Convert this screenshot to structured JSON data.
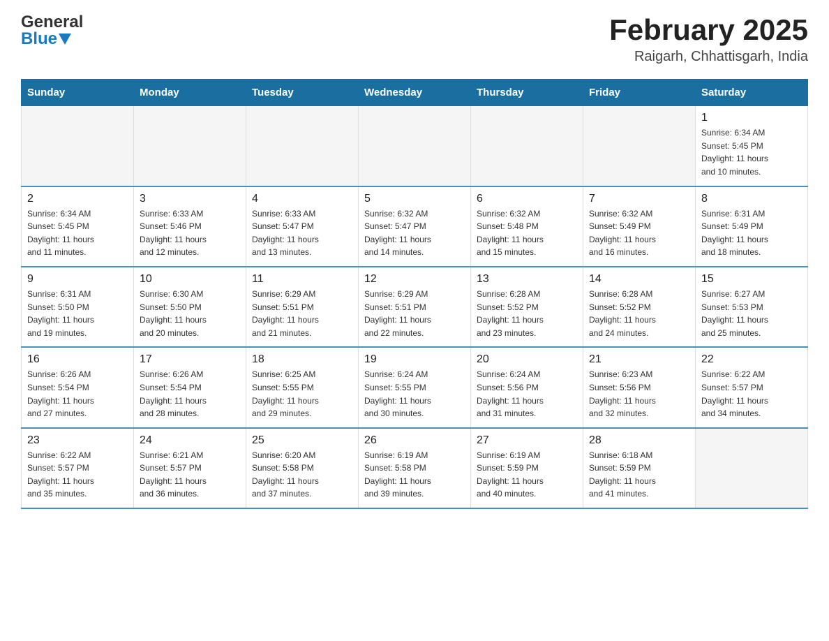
{
  "header": {
    "logo_general": "General",
    "logo_blue": "Blue",
    "month_title": "February 2025",
    "location": "Raigarh, Chhattisgarh, India"
  },
  "days_of_week": [
    "Sunday",
    "Monday",
    "Tuesday",
    "Wednesday",
    "Thursday",
    "Friday",
    "Saturday"
  ],
  "weeks": [
    {
      "days": [
        {
          "date": "",
          "info": ""
        },
        {
          "date": "",
          "info": ""
        },
        {
          "date": "",
          "info": ""
        },
        {
          "date": "",
          "info": ""
        },
        {
          "date": "",
          "info": ""
        },
        {
          "date": "",
          "info": ""
        },
        {
          "date": "1",
          "info": "Sunrise: 6:34 AM\nSunset: 5:45 PM\nDaylight: 11 hours\nand 10 minutes."
        }
      ]
    },
    {
      "days": [
        {
          "date": "2",
          "info": "Sunrise: 6:34 AM\nSunset: 5:45 PM\nDaylight: 11 hours\nand 11 minutes."
        },
        {
          "date": "3",
          "info": "Sunrise: 6:33 AM\nSunset: 5:46 PM\nDaylight: 11 hours\nand 12 minutes."
        },
        {
          "date": "4",
          "info": "Sunrise: 6:33 AM\nSunset: 5:47 PM\nDaylight: 11 hours\nand 13 minutes."
        },
        {
          "date": "5",
          "info": "Sunrise: 6:32 AM\nSunset: 5:47 PM\nDaylight: 11 hours\nand 14 minutes."
        },
        {
          "date": "6",
          "info": "Sunrise: 6:32 AM\nSunset: 5:48 PM\nDaylight: 11 hours\nand 15 minutes."
        },
        {
          "date": "7",
          "info": "Sunrise: 6:32 AM\nSunset: 5:49 PM\nDaylight: 11 hours\nand 16 minutes."
        },
        {
          "date": "8",
          "info": "Sunrise: 6:31 AM\nSunset: 5:49 PM\nDaylight: 11 hours\nand 18 minutes."
        }
      ]
    },
    {
      "days": [
        {
          "date": "9",
          "info": "Sunrise: 6:31 AM\nSunset: 5:50 PM\nDaylight: 11 hours\nand 19 minutes."
        },
        {
          "date": "10",
          "info": "Sunrise: 6:30 AM\nSunset: 5:50 PM\nDaylight: 11 hours\nand 20 minutes."
        },
        {
          "date": "11",
          "info": "Sunrise: 6:29 AM\nSunset: 5:51 PM\nDaylight: 11 hours\nand 21 minutes."
        },
        {
          "date": "12",
          "info": "Sunrise: 6:29 AM\nSunset: 5:51 PM\nDaylight: 11 hours\nand 22 minutes."
        },
        {
          "date": "13",
          "info": "Sunrise: 6:28 AM\nSunset: 5:52 PM\nDaylight: 11 hours\nand 23 minutes."
        },
        {
          "date": "14",
          "info": "Sunrise: 6:28 AM\nSunset: 5:52 PM\nDaylight: 11 hours\nand 24 minutes."
        },
        {
          "date": "15",
          "info": "Sunrise: 6:27 AM\nSunset: 5:53 PM\nDaylight: 11 hours\nand 25 minutes."
        }
      ]
    },
    {
      "days": [
        {
          "date": "16",
          "info": "Sunrise: 6:26 AM\nSunset: 5:54 PM\nDaylight: 11 hours\nand 27 minutes."
        },
        {
          "date": "17",
          "info": "Sunrise: 6:26 AM\nSunset: 5:54 PM\nDaylight: 11 hours\nand 28 minutes."
        },
        {
          "date": "18",
          "info": "Sunrise: 6:25 AM\nSunset: 5:55 PM\nDaylight: 11 hours\nand 29 minutes."
        },
        {
          "date": "19",
          "info": "Sunrise: 6:24 AM\nSunset: 5:55 PM\nDaylight: 11 hours\nand 30 minutes."
        },
        {
          "date": "20",
          "info": "Sunrise: 6:24 AM\nSunset: 5:56 PM\nDaylight: 11 hours\nand 31 minutes."
        },
        {
          "date": "21",
          "info": "Sunrise: 6:23 AM\nSunset: 5:56 PM\nDaylight: 11 hours\nand 32 minutes."
        },
        {
          "date": "22",
          "info": "Sunrise: 6:22 AM\nSunset: 5:57 PM\nDaylight: 11 hours\nand 34 minutes."
        }
      ]
    },
    {
      "days": [
        {
          "date": "23",
          "info": "Sunrise: 6:22 AM\nSunset: 5:57 PM\nDaylight: 11 hours\nand 35 minutes."
        },
        {
          "date": "24",
          "info": "Sunrise: 6:21 AM\nSunset: 5:57 PM\nDaylight: 11 hours\nand 36 minutes."
        },
        {
          "date": "25",
          "info": "Sunrise: 6:20 AM\nSunset: 5:58 PM\nDaylight: 11 hours\nand 37 minutes."
        },
        {
          "date": "26",
          "info": "Sunrise: 6:19 AM\nSunset: 5:58 PM\nDaylight: 11 hours\nand 39 minutes."
        },
        {
          "date": "27",
          "info": "Sunrise: 6:19 AM\nSunset: 5:59 PM\nDaylight: 11 hours\nand 40 minutes."
        },
        {
          "date": "28",
          "info": "Sunrise: 6:18 AM\nSunset: 5:59 PM\nDaylight: 11 hours\nand 41 minutes."
        },
        {
          "date": "",
          "info": ""
        }
      ]
    }
  ]
}
